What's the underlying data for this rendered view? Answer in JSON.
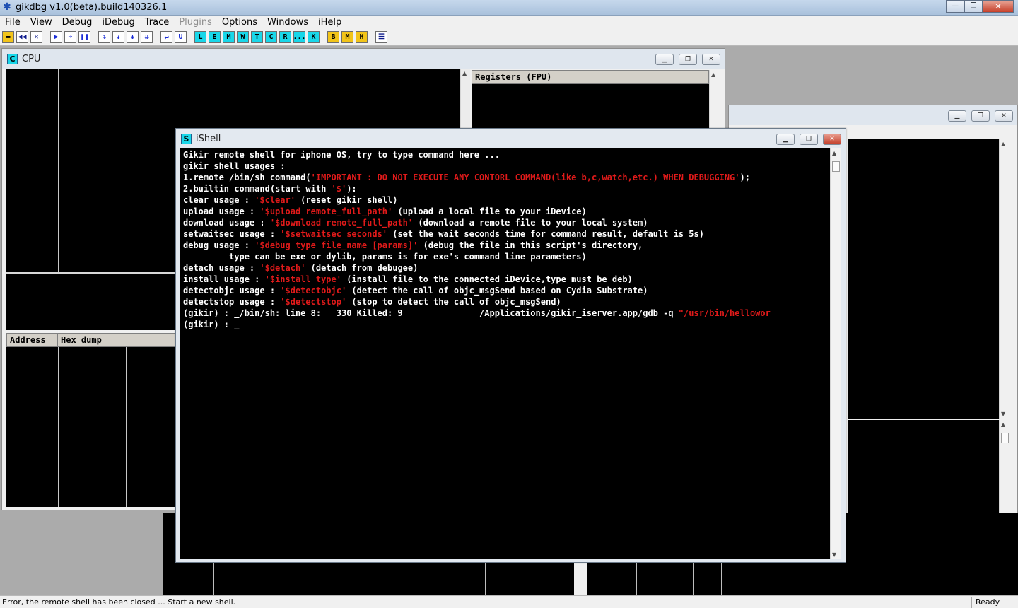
{
  "app": {
    "title": "gikdbg v1.0(beta).build140326.1",
    "icon": "snowflake-icon",
    "window_buttons": {
      "minimize": "—",
      "maximize": "❐",
      "close": "✕"
    }
  },
  "menu": [
    "File",
    "View",
    "Debug",
    "iDebug",
    "Trace",
    "Plugins",
    "Options",
    "Windows",
    "iHelp"
  ],
  "menu_disabled": [
    "Plugins"
  ],
  "toolbar": {
    "buttons": [
      {
        "icon": "open-folder-icon",
        "glyph": "▬"
      },
      {
        "icon": "rewind-icon",
        "glyph": "◀◀"
      },
      {
        "icon": "close-icon",
        "glyph": "✕"
      },
      {
        "icon": "run-icon",
        "glyph": "▶"
      },
      {
        "icon": "step-run-icon",
        "glyph": "➔"
      },
      {
        "icon": "pause-icon",
        "glyph": "❚❚"
      },
      {
        "icon": "step-into-icon",
        "glyph": "↴"
      },
      {
        "icon": "step-over-icon",
        "glyph": "⇣"
      },
      {
        "icon": "trace-into-icon",
        "glyph": "↡"
      },
      {
        "icon": "trace-over-icon",
        "glyph": "⇊"
      },
      {
        "icon": "execute-till-return-icon",
        "glyph": "↵"
      },
      {
        "icon": "execute-till-user-icon",
        "glyph": "U"
      }
    ],
    "window_letters": [
      "L",
      "E",
      "M",
      "W",
      "T",
      "C",
      "R",
      "...",
      "K"
    ],
    "extra_letters": [
      "B",
      "M",
      "H"
    ],
    "list_icon": "list-icon",
    "list_glyph": "☰"
  },
  "colors": {
    "window_letter_bg": "#19d7e9",
    "extra_letter_bg": "#f2c419",
    "console_red": "#e01a1a"
  },
  "cpu_window": {
    "icon_letter": "C",
    "title": "CPU",
    "registers_header": "Registers (FPU)",
    "dump_headers": [
      "Address",
      "Hex dump"
    ]
  },
  "ishell_window": {
    "icon_letter": "S",
    "title": "iShell",
    "console_lines": [
      [
        {
          "t": "Gikir remote shell for iphone OS, try to type command here ..."
        }
      ],
      [
        {
          "t": "gikir shell usages :"
        }
      ],
      [
        {
          "t": "1.remote /bin/sh command("
        },
        {
          "t": "'IMPORTANT : DO NOT EXECUTE ANY CONTORL COMMAND(like b,c,watch,etc.) WHEN DEBUGGING'",
          "c": "red"
        },
        {
          "t": ");"
        }
      ],
      [
        {
          "t": "2.builtin command(start with "
        },
        {
          "t": "'$'",
          "c": "red"
        },
        {
          "t": "):"
        }
      ],
      [
        {
          "t": "clear usage : "
        },
        {
          "t": "'$clear'",
          "c": "red"
        },
        {
          "t": " (reset gikir shell)"
        }
      ],
      [
        {
          "t": "upload usage : "
        },
        {
          "t": "'$upload remote_full_path'",
          "c": "red"
        },
        {
          "t": " (upload a local file to your iDevice)"
        }
      ],
      [
        {
          "t": "download usage : "
        },
        {
          "t": "'$download remote_full_path'",
          "c": "red"
        },
        {
          "t": " (download a remote file to your local system)"
        }
      ],
      [
        {
          "t": "setwaitsec usage : "
        },
        {
          "t": "'$setwaitsec seconds'",
          "c": "red"
        },
        {
          "t": " (set the wait seconds time for command result, default is 5s)"
        }
      ],
      [
        {
          "t": "debug usage : "
        },
        {
          "t": "'$debug type file_name [params]'",
          "c": "red"
        },
        {
          "t": " (debug the file in this script's directory,"
        }
      ],
      [
        {
          "t": "         type can be exe or dylib, params is for exe's command line parameters)"
        }
      ],
      [
        {
          "t": "detach usage : "
        },
        {
          "t": "'$detach'",
          "c": "red"
        },
        {
          "t": " (detach from debugee)"
        }
      ],
      [
        {
          "t": "install usage : "
        },
        {
          "t": "'$install type'",
          "c": "red"
        },
        {
          "t": " (install file to the connected iDevice,type must be deb)"
        }
      ],
      [
        {
          "t": "detectobjc usage : "
        },
        {
          "t": "'$detectobjc'",
          "c": "red"
        },
        {
          "t": " (detect the call of objc_msgSend based on Cydia Substrate)"
        }
      ],
      [
        {
          "t": "detectstop usage : "
        },
        {
          "t": "'$detectstop'",
          "c": "red"
        },
        {
          "t": " (stop to detect the call of objc_msgSend)"
        }
      ],
      [
        {
          "t": "(gikir) : _/bin/sh: line 8:   330 Killed: 9               /Applications/gikir_iserver.app/gdb -q "
        },
        {
          "t": "\"/usr/bin/hellowor",
          "c": "red"
        }
      ],
      [
        {
          "t": "(gikir) : _"
        }
      ]
    ]
  },
  "status": {
    "message": "Error, the remote shell has been closed ... Start a new shell.",
    "state": "Ready"
  }
}
